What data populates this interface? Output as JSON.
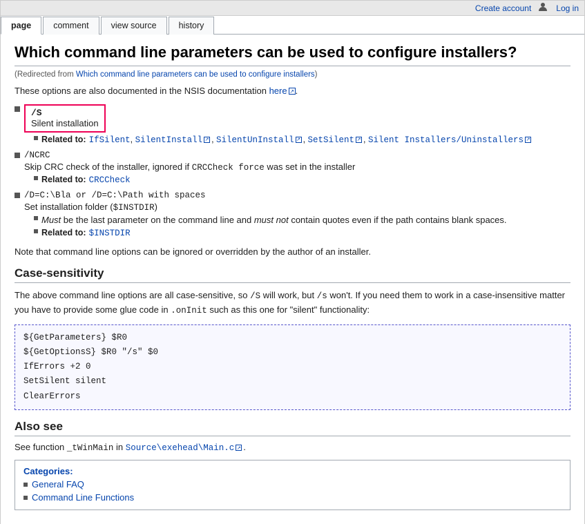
{
  "topbar": {
    "create_account": "Create account",
    "log_in": "Log in"
  },
  "tabs": [
    {
      "label": "page",
      "active": true
    },
    {
      "label": "comment",
      "active": false
    },
    {
      "label": "view source",
      "active": false
    },
    {
      "label": "history",
      "active": false
    }
  ],
  "page": {
    "title": "Which command line parameters can be used to configure installers?",
    "redirect_text": "Redirected from",
    "redirect_link_text": "Which command line parameters can be used to configure installers",
    "intro": "These options are also documented in the NSIS documentation",
    "intro_link": "here",
    "params": [
      {
        "code": "/S",
        "highlighted": true,
        "description": "Silent installation",
        "related_label": "Related to:",
        "related_items": [
          {
            "text": "IfSilent",
            "link": true
          },
          {
            "text": "SilentInstall",
            "link": true
          },
          {
            "text": "SilentUnInstall",
            "link": true
          },
          {
            "text": "SetSilent",
            "link": true
          },
          {
            "text": "Silent Installers/Uninstallers",
            "link": true
          }
        ]
      },
      {
        "code": "/NCRC",
        "highlighted": false,
        "description": "Skip CRC check of the installer, ignored if CRCCheck force was set in the installer",
        "related_label": "Related to:",
        "related_items": [
          {
            "text": "CRCCheck",
            "link": true
          }
        ]
      },
      {
        "code": "/D=C:\\Bla or /D=C:\\Path with spaces",
        "highlighted": false,
        "description": "Set installation folder ($INSTDIR)",
        "sub_notes": [
          "Must be the last parameter on the command line and must not contain quotes even if the path contains blank spaces."
        ],
        "related_label": "Related to:",
        "related_items": [
          {
            "text": "$INSTDIR",
            "link": true
          }
        ]
      }
    ],
    "note": "Note that command line options can be ignored or overridden by the author of an installer.",
    "case_sensitivity": {
      "title": "Case-sensitivity",
      "text1": "The above command line options are all case-sensitive, so ",
      "code1": "/S",
      "text2": " will work, but ",
      "code2": "/s",
      "text3": " won't. If you need them to work in a case-insensitive matter you have to provide some glue code in ",
      "code3": ".onInit",
      "text4": " such as this one for \"silent\" functionality:"
    },
    "code_block": "${GetParameters} $R0\n${GetOptionsS} $R0 \"/s\" $0\nIfErrors +2 0\nSetSilent silent\nClearErrors",
    "also_see": {
      "title": "Also see",
      "text": "See function ",
      "func": "_tWinMain",
      "text2": " in ",
      "path": "Source\\exehead\\Main.c",
      "text3": "."
    },
    "categories": {
      "title": "Categories:",
      "items": [
        {
          "label": "General FAQ"
        },
        {
          "label": "Command Line Functions"
        }
      ]
    }
  }
}
